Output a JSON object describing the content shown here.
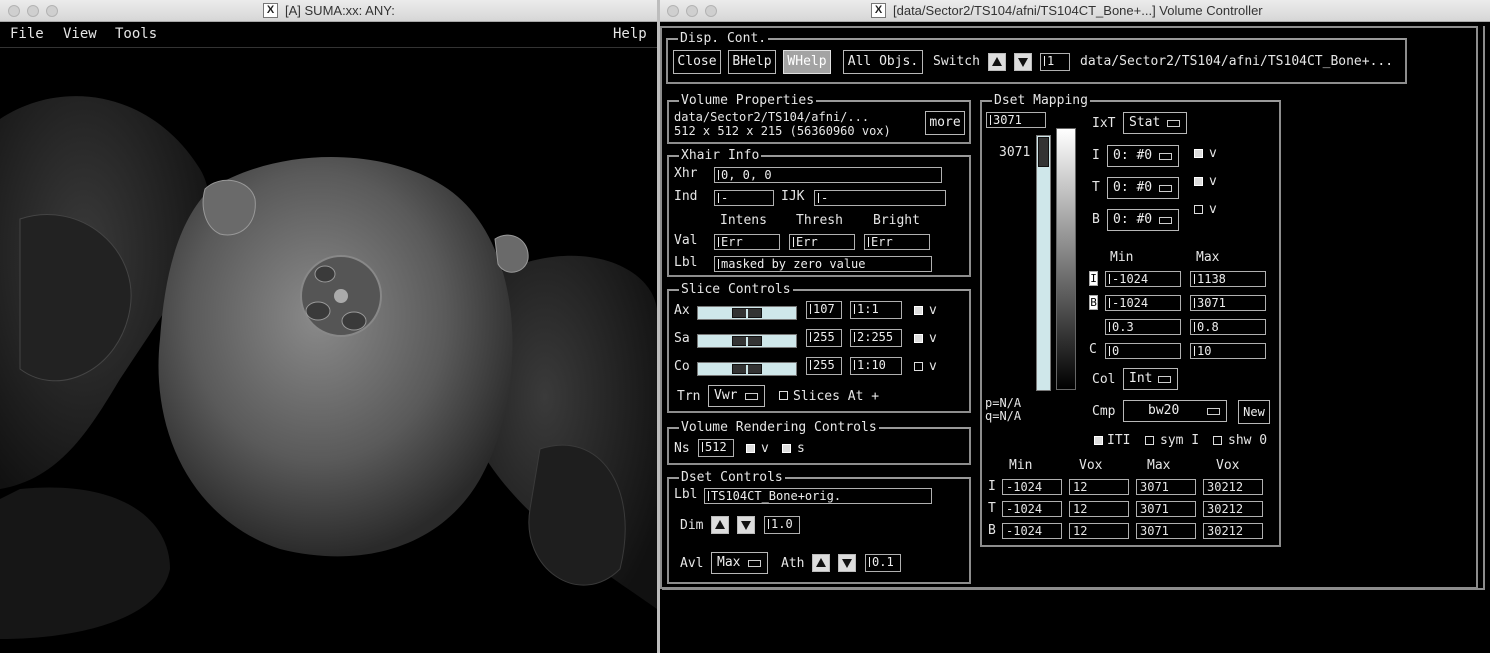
{
  "suma": {
    "title": "[A] SUMA:xx: ANY:",
    "menus": {
      "file": "File",
      "view": "View",
      "tools": "Tools",
      "help": "Help"
    }
  },
  "vc": {
    "title": "[data/Sector2/TS104/afni/TS104CT_Bone+...] Volume Controller",
    "disp": {
      "label": "Disp. Cont.",
      "close": "Close",
      "bhelp": "BHelp",
      "whelp": "WHelp",
      "all_objs": "All Objs.",
      "switch": "Switch",
      "switch_value": "1",
      "path": "data/Sector2/TS104/afni/TS104CT_Bone+..."
    },
    "volprop": {
      "label": "Volume Properties",
      "line1": "data/Sector2/TS104/afni/...",
      "line2": "512 x 512 x 215 (56360960 vox)",
      "more": "more"
    },
    "xhair": {
      "label": "Xhair Info",
      "xhr": "Xhr",
      "xhr_value": "0, 0, 0",
      "ind": "Ind",
      "ind_value": "-",
      "ijk": "IJK",
      "ijk_value": "-",
      "intens": "Intens",
      "thresh": "Thresh",
      "bright": "Bright",
      "val": "Val",
      "v1": "Err",
      "v2": "Err",
      "v3": "Err",
      "lbl": "Lbl",
      "lbl_value": "masked by zero value"
    },
    "slice": {
      "label": "Slice Controls",
      "ax": "Ax",
      "ax_num": "107",
      "ax_rng": "1:1",
      "sa": "Sa",
      "sa_num": "255",
      "sa_rng": "2:255",
      "co": "Co",
      "co_num": "255",
      "co_rng": "1:10",
      "v": "v",
      "trn": "Trn",
      "trn_value": "Vwr",
      "slices_at": "Slices At +"
    },
    "vr": {
      "label": "Volume Rendering Controls",
      "ns": "Ns",
      "ns_value": "512",
      "v": "v",
      "s": "s"
    },
    "dset": {
      "label": "Dset Controls",
      "lbl": "Lbl",
      "lbl_value": "TS104CT_Bone+orig.",
      "dim": "Dim",
      "dim_value": "1.0",
      "avl": "Avl",
      "avl_value": "Max",
      "ath": "Ath",
      "ath_value": "0.1"
    },
    "map": {
      "label": "Dset Mapping",
      "top_value": "3071",
      "scale_value": "3071",
      "pval": "p=N/A",
      "qval": "q=N/A",
      "ixt": "IxT",
      "ixt_value": "Stat",
      "i": "I",
      "i_value": "0: #0",
      "t": "T",
      "t_value": "0: #0",
      "b": "B",
      "b_value": "0: #0",
      "v": "v",
      "min": "Min",
      "max": "Max",
      "i_min": "-1024",
      "i_max": "1138",
      "b_min": "-1024",
      "b_max": "3071",
      "r3_min": "0.3",
      "r3_max": "0.8",
      "c": "C",
      "c_min": "0",
      "c_max": "10",
      "col": "Col",
      "col_value": "Int",
      "cmp": "Cmp",
      "cmp_value": "bw20",
      "new": "New",
      "iti": "ITI",
      "sym": "sym I",
      "shw": "shw 0",
      "tbl_min": "Min",
      "tbl_vox": "Vox",
      "tbl_max": "Max",
      "tbl_vox2": "Vox",
      "rows": [
        {
          "k": "I",
          "min": "-1024",
          "vox": "12",
          "max": "3071",
          "vox2": "30212"
        },
        {
          "k": "T",
          "min": "-1024",
          "vox": "12",
          "max": "3071",
          "vox2": "30212"
        },
        {
          "k": "B",
          "min": "-1024",
          "vox": "12",
          "max": "3071",
          "vox2": "30212"
        }
      ]
    }
  },
  "colors": {
    "slider": "#cfe7ea",
    "bar": "#cfe7ea",
    "frame": "#8d8d8d"
  }
}
